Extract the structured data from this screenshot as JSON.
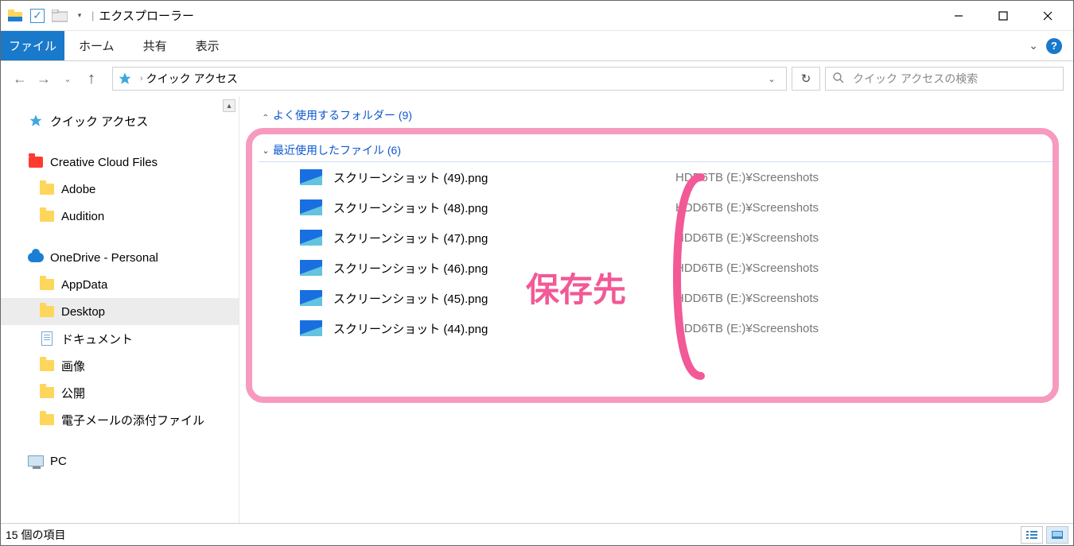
{
  "title": "エクスプローラー",
  "ribbon": {
    "file": "ファイル",
    "tabs": [
      "ホーム",
      "共有",
      "表示"
    ]
  },
  "breadcrumb": {
    "location": "クイック アクセス"
  },
  "search": {
    "placeholder": "クイック アクセスの検索"
  },
  "sidebar": {
    "quick_access": "クイック アクセス",
    "creative": "Creative Cloud Files",
    "onedrive": "OneDrive - Personal",
    "pc": "PC",
    "items_a": [
      "Adobe",
      "Audition"
    ],
    "items_b": [
      "AppData",
      "Desktop",
      "ドキュメント",
      "画像",
      "公開",
      "電子メールの添付ファイル"
    ]
  },
  "groups": {
    "frequent": "よく使用するフォルダー (9)",
    "recent": "最近使用したファイル (6)"
  },
  "files": [
    {
      "name": "スクリーンショット (49).png",
      "path": "HDD6TB (E:)¥Screenshots"
    },
    {
      "name": "スクリーンショット (48).png",
      "path": "HDD6TB (E:)¥Screenshots"
    },
    {
      "name": "スクリーンショット (47).png",
      "path": "HDD6TB (E:)¥Screenshots"
    },
    {
      "name": "スクリーンショット (46).png",
      "path": "HDD6TB (E:)¥Screenshots"
    },
    {
      "name": "スクリーンショット (45).png",
      "path": "HDD6TB (E:)¥Screenshots"
    },
    {
      "name": "スクリーンショット (44).png",
      "path": "HDD6TB (E:)¥Screenshots"
    }
  ],
  "annotation": "保存先",
  "status": "15 個の項目"
}
